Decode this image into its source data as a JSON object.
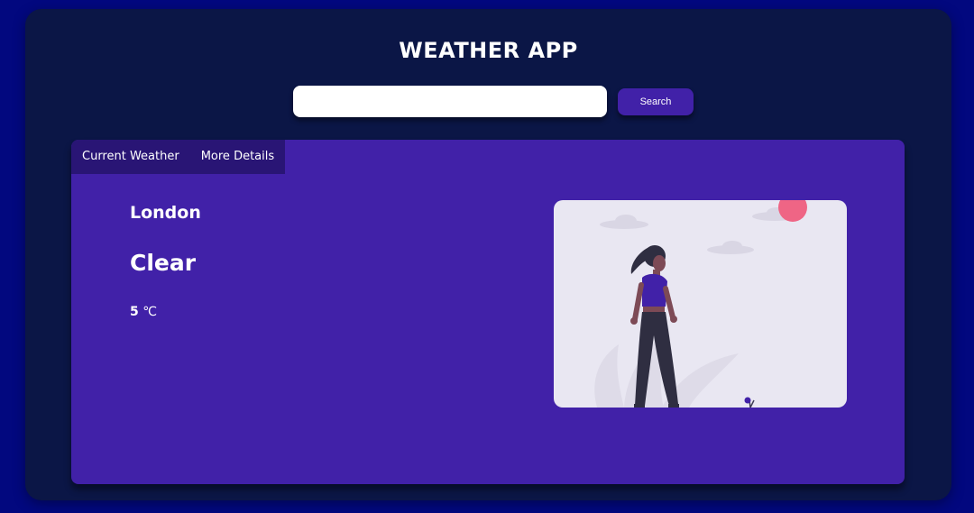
{
  "app": {
    "title": "WEATHER APP"
  },
  "search": {
    "value": "",
    "placeholder": "",
    "button_label": "Search"
  },
  "tabs": [
    {
      "label": "Current Weather",
      "active": true
    },
    {
      "label": "More Details",
      "active": false
    }
  ],
  "weather": {
    "city": "London",
    "condition": "Clear",
    "temperature": "5",
    "unit": "℃"
  },
  "illustration": {
    "icon": "person-standing-outdoors-illustration"
  },
  "colors": {
    "page_background": "#02087f",
    "shell_background": "#0b1646",
    "accent": "#4121a8",
    "tab_bar": "#291575",
    "sun": "#ef6585",
    "illustration_background": "#e9e7f2"
  }
}
